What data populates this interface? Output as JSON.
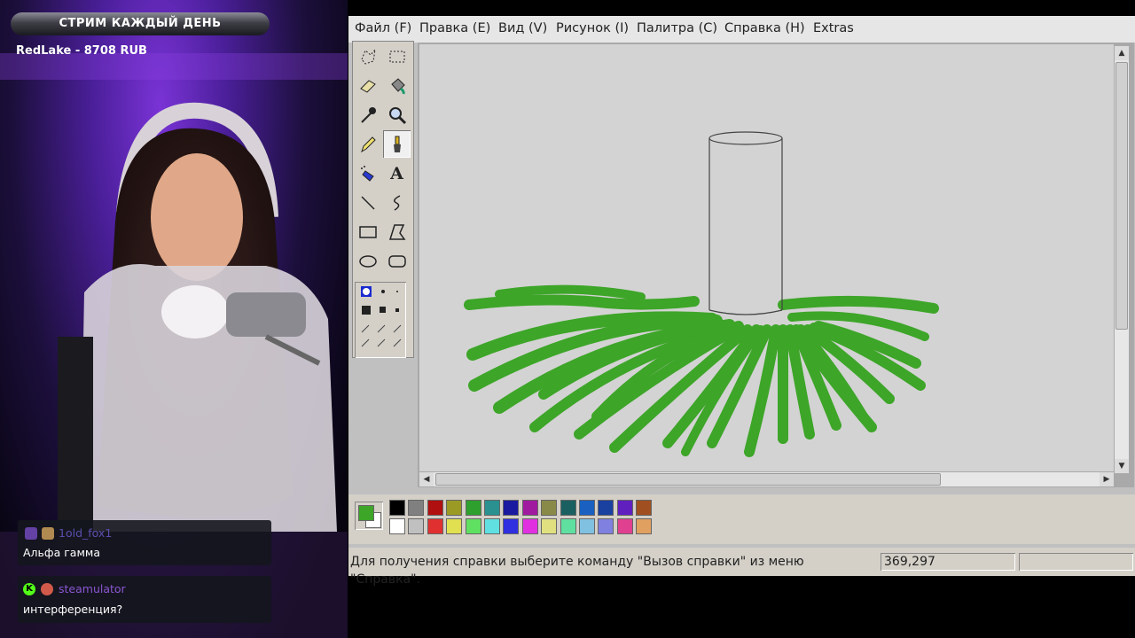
{
  "overlay": {
    "banner": "СТРИМ КАЖДЫЙ ДЕНЬ",
    "donation": "RedLake - 8708 RUB"
  },
  "chat": [
    {
      "user": "1old_fox1",
      "text": "Альфа гамма",
      "user_color": "#5a4fae",
      "badge": "twitch-icon"
    },
    {
      "user": "steamulator",
      "text": "интерференция?",
      "user_color": "#8a56d0",
      "badge": "kick-icon"
    }
  ],
  "menu": [
    "Файл (F)",
    "Правка (E)",
    "Вид (V)",
    "Рисунок (I)",
    "Палитра (C)",
    "Справка (H)",
    "Extras"
  ],
  "tools": [
    "free-select-icon",
    "rect-select-icon",
    "eraser-icon",
    "fill-bucket-icon",
    "color-picker-icon",
    "magnifier-icon",
    "pencil-icon",
    "brush-icon",
    "airbrush-icon",
    "text-icon",
    "line-icon",
    "curve-icon",
    "rectangle-icon",
    "polygon-icon",
    "ellipse-icon",
    "rounded-rect-icon"
  ],
  "text_tool_glyph": "A",
  "selected_tool": "brush-icon",
  "colors": {
    "foreground": "#3da528",
    "background": "#ffffff",
    "palette_row1": [
      "#000000",
      "#808080",
      "#b01010",
      "#9a9a24",
      "#2ea02e",
      "#2a9090",
      "#1a1aa0",
      "#a01aa0",
      "#8a8a48",
      "#1a6060",
      "#1a60c0",
      "#1a40a0",
      "#6020c0",
      "#a05020"
    ],
    "palette_row2": [
      "#ffffff",
      "#c0c0c0",
      "#e03030",
      "#e0e050",
      "#60e060",
      "#60e0e0",
      "#3030e0",
      "#e030e0",
      "#e0e080",
      "#60e0a0",
      "#80c0e0",
      "#8080e0",
      "#e04090",
      "#e0a060"
    ]
  },
  "status": {
    "help": "Для получения справки выберите команду \"Вызов справки\" из меню \"Справка\".",
    "coords": "369,297"
  }
}
